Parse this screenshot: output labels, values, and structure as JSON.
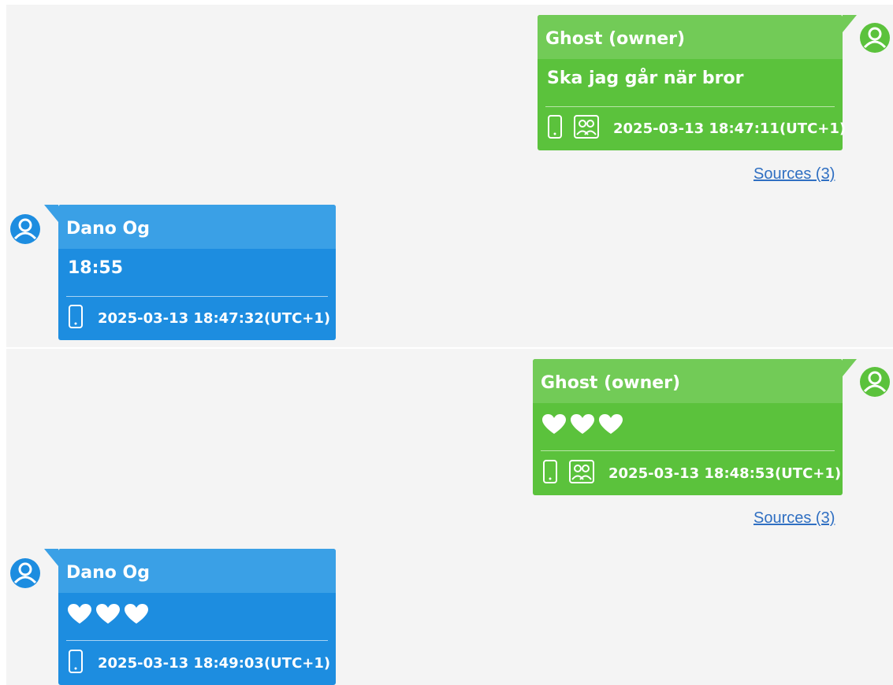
{
  "colors": {
    "outgoing_bubble": "#5bc23c",
    "outgoing_header": "#72cb57",
    "incoming_bubble": "#1d8de0",
    "incoming_header": "#3aa0e6",
    "background": "#f4f4f4",
    "link": "#2f6fc2"
  },
  "icons": {
    "device": "phone-icon",
    "group": "group-icon",
    "outgoing_avatar": "user-avatar-icon",
    "incoming_avatar": "user-avatar-icon",
    "heart": "heart-icon"
  },
  "messages": [
    {
      "direction": "outgoing",
      "sender": "Ghost (owner)",
      "text": "Ska jag går när bror",
      "timestamp": "2025-03-13 18:47:11(UTC+1)",
      "sources": "Sources (3)"
    },
    {
      "direction": "incoming",
      "sender": "Dano Og",
      "text": "18:55",
      "timestamp": "2025-03-13 18:47:32(UTC+1)"
    },
    {
      "direction": "outgoing",
      "sender": "Ghost (owner)",
      "text": "hearts x3",
      "timestamp": "2025-03-13 18:48:53(UTC+1)",
      "sources": "Sources (3)"
    },
    {
      "direction": "incoming",
      "sender": "Dano Og",
      "text": "hearts x3",
      "timestamp": "2025-03-13 18:49:03(UTC+1)"
    }
  ]
}
